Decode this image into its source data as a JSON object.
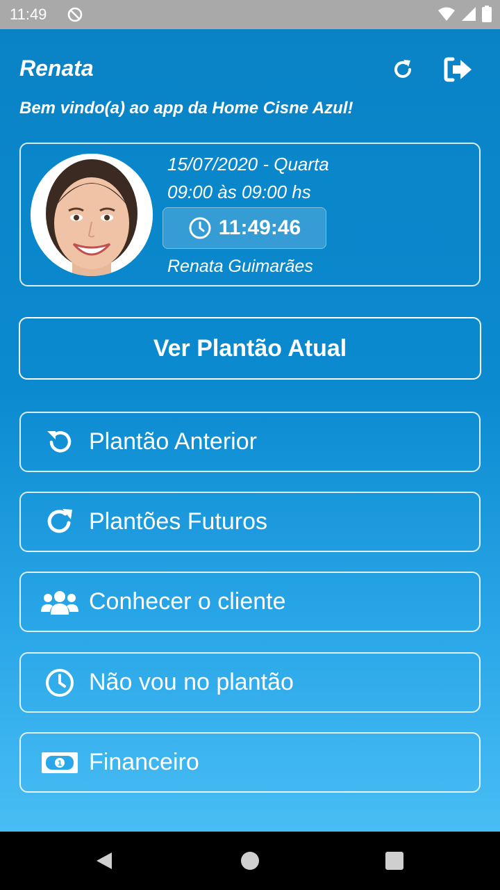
{
  "status_bar": {
    "time": "11:49"
  },
  "header": {
    "user_name": "Renata",
    "welcome": "Bem vindo(a) ao app da Home Cisne Azul!"
  },
  "shift_card": {
    "date": "15/07/2020 - Quarta",
    "hours": "09:00 às 09:00 hs",
    "clock": "11:49:46",
    "person": "Renata Guimarães"
  },
  "primary_button": {
    "label": "Ver Plantão Atual"
  },
  "menu": [
    {
      "label": "Plantão Anterior",
      "icon": "undo-icon"
    },
    {
      "label": "Plantões Futuros",
      "icon": "redo-icon"
    },
    {
      "label": "Conhecer o cliente",
      "icon": "users-icon"
    },
    {
      "label": "Não vou no plantão",
      "icon": "clock-icon"
    },
    {
      "label": "Financeiro",
      "icon": "money-icon"
    }
  ],
  "colors": {
    "app_top": "#0a83c6",
    "app_bottom": "#48bdf4",
    "status_bar": "#a9a9a9",
    "nav_bar": "#000000"
  }
}
